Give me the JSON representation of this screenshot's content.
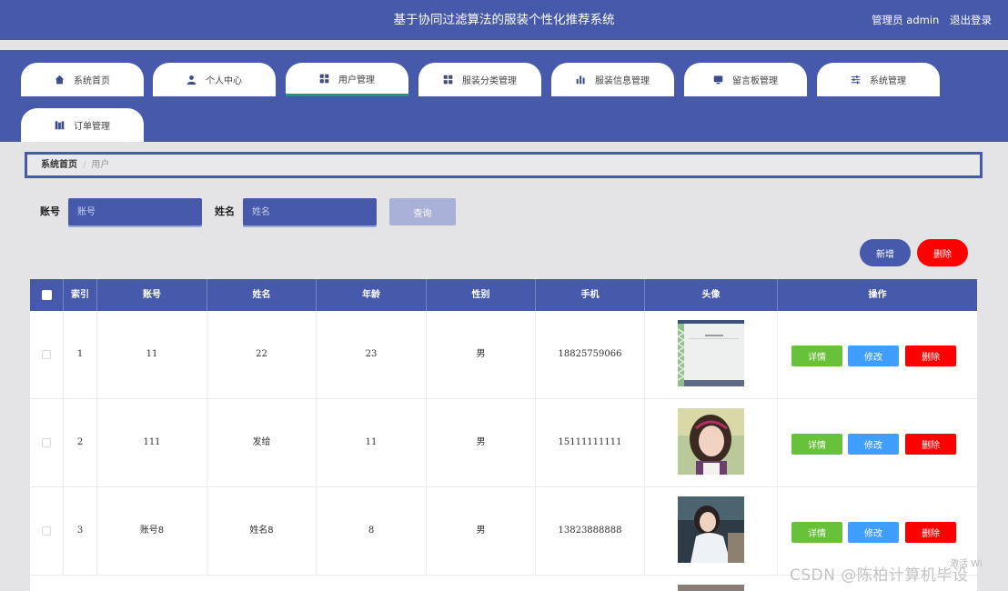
{
  "header": {
    "title": "基于协同过滤算法的服装个性化推荐系统",
    "user_role": "管理员 admin",
    "logout_label": "退出登录"
  },
  "nav": {
    "tabs": [
      {
        "label": "系统首页",
        "icon": "home-icon"
      },
      {
        "label": "个人中心",
        "icon": "person-icon"
      },
      {
        "label": "用户管理",
        "icon": "grid-icon",
        "active": true
      },
      {
        "label": "服装分类管理",
        "icon": "grid-icon"
      },
      {
        "label": "服装信息管理",
        "icon": "bar-chart-icon"
      },
      {
        "label": "留言板管理",
        "icon": "message-icon"
      },
      {
        "label": "系统管理",
        "icon": "sliders-icon"
      },
      {
        "label": "订单管理",
        "icon": "order-icon"
      }
    ]
  },
  "breadcrumb": {
    "home": "系统首页",
    "separator": "/",
    "current": "用户"
  },
  "search": {
    "account_label": "账号",
    "account_placeholder": "账号",
    "name_label": "姓名",
    "name_placeholder": "姓名",
    "query_label": "查询"
  },
  "actions": {
    "add_label": "新增",
    "delete_label": "删除"
  },
  "table": {
    "columns": [
      "索引",
      "账号",
      "姓名",
      "年龄",
      "性别",
      "手机",
      "头像",
      "操作"
    ],
    "rows": [
      {
        "index": "1",
        "account": "11",
        "name": "22",
        "age": "23",
        "gender": "男",
        "phone": "18825759066",
        "avatar": "screenshot-thumbnail"
      },
      {
        "index": "2",
        "account": "111",
        "name": "发给",
        "age": "11",
        "gender": "男",
        "phone": "15111111111",
        "avatar": "girl-photo"
      },
      {
        "index": "3",
        "account": "账号8",
        "name": "姓名8",
        "age": "8",
        "gender": "男",
        "phone": "13823888888",
        "avatar": "girl-photo-2"
      }
    ],
    "row_actions": {
      "detail": "详情",
      "edit": "修改",
      "delete": "删除"
    }
  },
  "watermark": "CSDN @陈柏计算机毕设",
  "activate_hint": "激活 Wi",
  "colors": {
    "primary": "#4659aa",
    "detail": "#67c23a",
    "edit": "#409eff",
    "danger": "#ff0000"
  }
}
